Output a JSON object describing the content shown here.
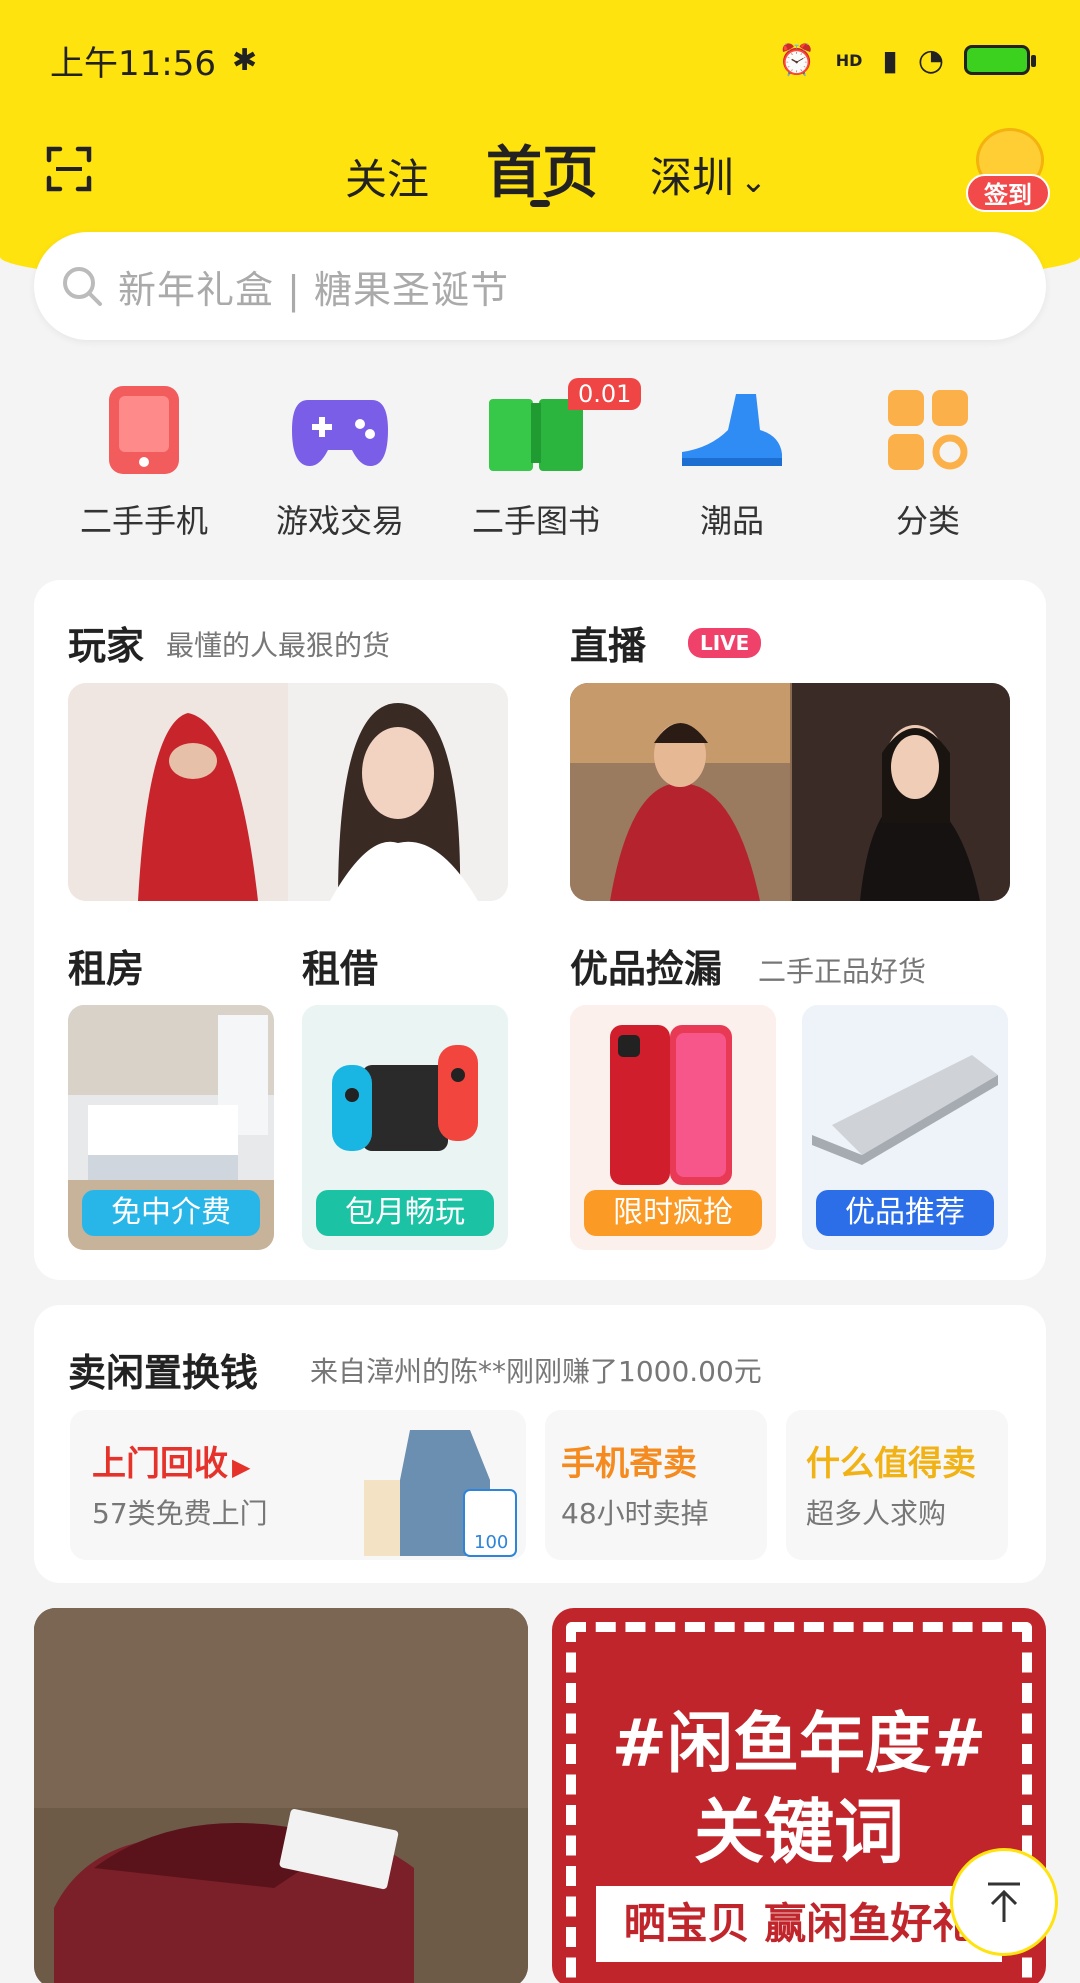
{
  "status_bar": {
    "time": "上午11:56",
    "network": "HD"
  },
  "nav": {
    "tab_follow": "关注",
    "tab_home": "首页",
    "city": "深圳",
    "checkin": "签到"
  },
  "search": {
    "placeholder": "新年礼盒 | 糖果圣诞节"
  },
  "categories": [
    {
      "label": "二手手机",
      "icon": "phone-icon"
    },
    {
      "label": "游戏交易",
      "icon": "gamepad-icon"
    },
    {
      "label": "二手图书",
      "icon": "book-icon",
      "badge": "0.01"
    },
    {
      "label": "潮品",
      "icon": "sneaker-icon"
    },
    {
      "label": "分类",
      "icon": "grid-icon"
    }
  ],
  "players": {
    "title": "玩家",
    "subtitle": "最懂的人最狠的货"
  },
  "live": {
    "title": "直播",
    "badge": "LIVE"
  },
  "rent": {
    "title": "租房",
    "pill": "免中介费"
  },
  "borrow": {
    "title": "租借",
    "pill": "包月畅玩"
  },
  "picks": {
    "title": "优品捡漏",
    "subtitle": "二手正品好货",
    "pill1": "限时疯抢",
    "pill2": "优品推荐"
  },
  "sell": {
    "title": "卖闲置换钱",
    "ticker": "来自漳州的陈**刚刚赚了1000.00元",
    "recycle": {
      "title": "上门回收",
      "sub": "57类免费上门",
      "item_label": "100"
    },
    "consign": {
      "title": "手机寄卖",
      "sub": "48小时卖掉"
    },
    "worth": {
      "title": "什么值得卖",
      "sub": "超多人求购"
    }
  },
  "feed": {
    "banner_line1": "#闲鱼年度#",
    "banner_line2": "关键词",
    "banner_line3": "晒宝贝 赢闲鱼好礼"
  },
  "colors": {
    "brand_yellow": "#ffe30f",
    "accent_red": "#f04545"
  }
}
